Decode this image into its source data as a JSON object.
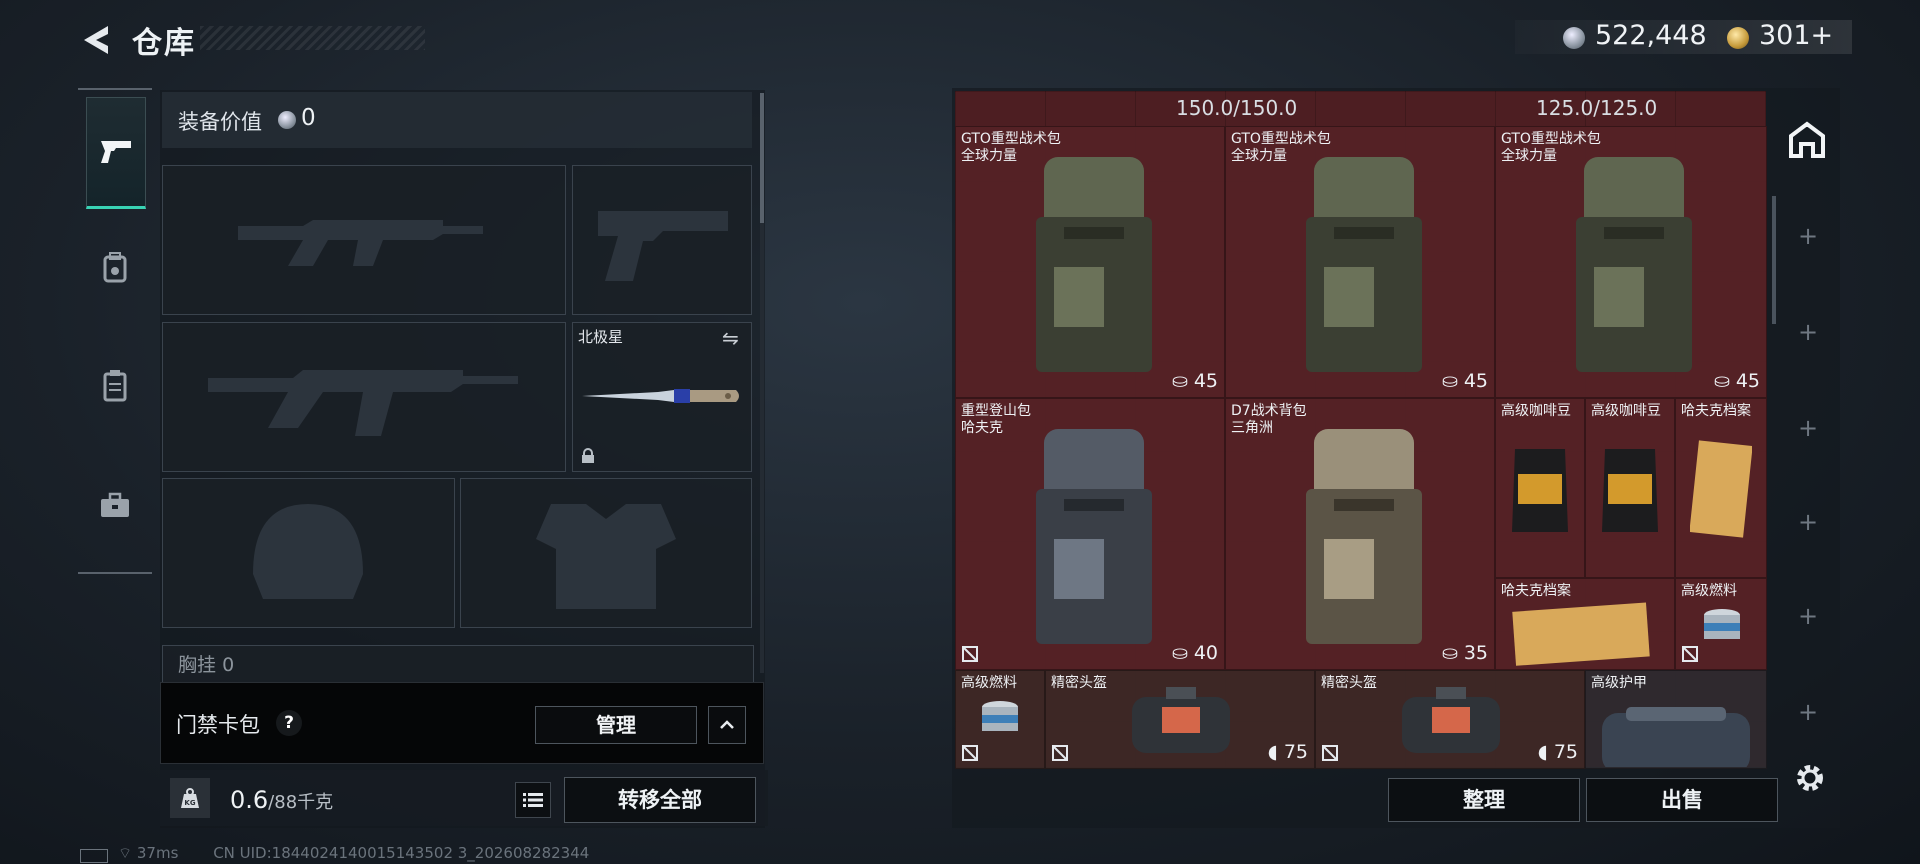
{
  "header": {
    "title": "仓库",
    "back_icon": "back-arrow-icon",
    "currency": [
      {
        "icon": "silver-coin-icon",
        "value": "522,448"
      },
      {
        "icon": "gold-coin-icon",
        "value": "301+"
      }
    ]
  },
  "sidebar": {
    "tabs": [
      {
        "icon": "pistol-icon",
        "active": true
      },
      {
        "icon": "backpack-icon",
        "active": false
      },
      {
        "icon": "vest-icon",
        "active": false
      },
      {
        "icon": "toolbox-icon",
        "active": false
      }
    ],
    "accent": "#38d3b4"
  },
  "loadout": {
    "value_label": "装备价值",
    "value": "0",
    "melee_name": "北极星",
    "chest_label": "胸挂",
    "chest_value": "0"
  },
  "card_pack": {
    "label": "门禁卡包",
    "help": "?",
    "manage_label": "管理"
  },
  "weight": {
    "current": "0.6",
    "max": "/88千克",
    "icon_text": "KG",
    "transfer_label": "转移全部"
  },
  "status": {
    "ping": "37ms",
    "uid": "CN UID:1844024140015143502 3_202608282344"
  },
  "storage": {
    "capacity_left": "150.0/150.0",
    "capacity_right": "125.0/125.0",
    "items": [
      {
        "name": "GTO重型战术包",
        "sub": "全球力量",
        "count": "45"
      },
      {
        "name": "GTO重型战术包",
        "sub": "全球力量",
        "count": "45"
      },
      {
        "name": "GTO重型战术包",
        "sub": "全球力量",
        "count": "45"
      },
      {
        "name": "重型登山包",
        "sub": "哈夫克",
        "count": "40"
      },
      {
        "name": "D7战术背包",
        "sub": "三角洲",
        "count": "35"
      },
      {
        "name": "高级咖啡豆"
      },
      {
        "name": "高级咖啡豆"
      },
      {
        "name": "哈夫克档案"
      },
      {
        "name": "哈夫克档案"
      },
      {
        "name": "高级燃料"
      },
      {
        "name": "高级燃料"
      },
      {
        "name": "精密头盔",
        "count": "75"
      },
      {
        "name": "精密头盔",
        "count": "75"
      },
      {
        "name": "高级护甲"
      }
    ],
    "cell_color": "#552226",
    "sort_label": "整理",
    "sell_label": "出售"
  }
}
